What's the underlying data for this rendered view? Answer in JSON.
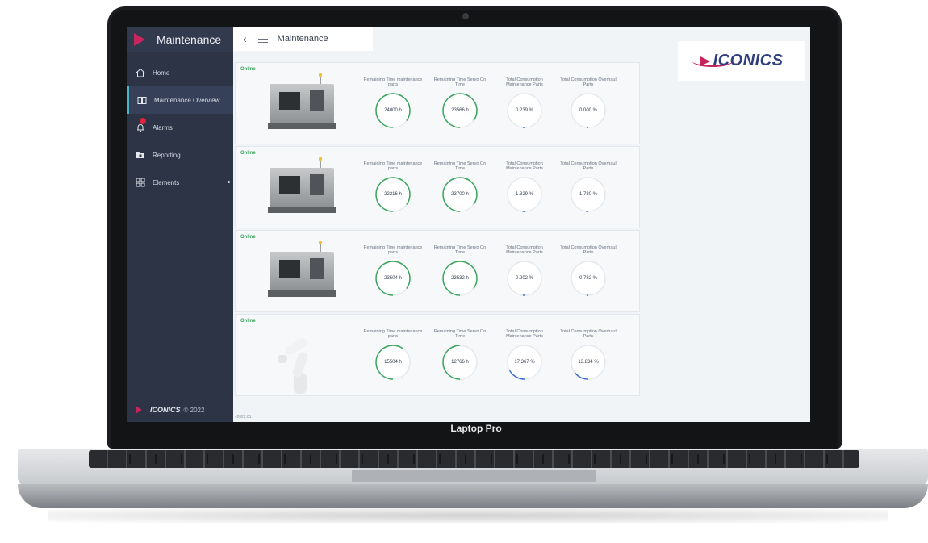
{
  "device": {
    "brand_label": "Laptop Pro"
  },
  "sidebar": {
    "title": "Maintenance",
    "items": [
      {
        "label": "Home",
        "icon": "home-icon"
      },
      {
        "label": "Maintenance Overview",
        "icon": "book-icon",
        "active": true
      },
      {
        "label": "Alarms",
        "icon": "bell-icon"
      },
      {
        "label": "Reporting",
        "icon": "folder-icon"
      },
      {
        "label": "Elements",
        "icon": "grid-icon"
      }
    ],
    "footer_brand": "ICONICS",
    "footer_copyright": "© 2022"
  },
  "topbar": {
    "title": "Maintenance"
  },
  "logo": {
    "text": "ICONICS",
    "accent_color": "#c8245e",
    "text_color": "#2f3f7e"
  },
  "version": "v2022.01",
  "machines": [
    {
      "status": "Online",
      "type": "cnc",
      "metrics": [
        {
          "label": "Remaining Time maintenance parts",
          "value": "24000 h",
          "fraction": 0.85,
          "color": "#3aa55c"
        },
        {
          "label": "Remaining Time Servo On Time",
          "value": "23566 h",
          "fraction": 0.85,
          "color": "#3aa55c"
        },
        {
          "label": "Total Consumption Maintenance Parts",
          "value": "0.239 %",
          "fraction": 0.01,
          "color": "#3b6fd6"
        },
        {
          "label": "Total Consumption Overhaul Parts",
          "value": "0.000 %",
          "fraction": 0.0,
          "color": "#3b6fd6"
        }
      ]
    },
    {
      "status": "Online",
      "type": "cnc",
      "metrics": [
        {
          "label": "Remaining Time maintenance parts",
          "value": "22216 h",
          "fraction": 0.85,
          "color": "#3aa55c"
        },
        {
          "label": "Remaining Time Servo On Time",
          "value": "23700 h",
          "fraction": 0.85,
          "color": "#3aa55c"
        },
        {
          "label": "Total Consumption Maintenance Parts",
          "value": "1.329 %",
          "fraction": 0.02,
          "color": "#3b6fd6"
        },
        {
          "label": "Total Consumption Overhaul Parts",
          "value": "1.780 %",
          "fraction": 0.02,
          "color": "#3b6fd6"
        }
      ]
    },
    {
      "status": "Online",
      "type": "cnc",
      "metrics": [
        {
          "label": "Remaining Time maintenance parts",
          "value": "23504 h",
          "fraction": 0.85,
          "color": "#3aa55c"
        },
        {
          "label": "Remaining Time Servo On Time",
          "value": "23532 h",
          "fraction": 0.85,
          "color": "#3aa55c"
        },
        {
          "label": "Total Consumption Maintenance Parts",
          "value": "0.202 %",
          "fraction": 0.01,
          "color": "#3b6fd6"
        },
        {
          "label": "Total Consumption Overhaul Parts",
          "value": "0.782 %",
          "fraction": 0.01,
          "color": "#3b6fd6"
        }
      ]
    },
    {
      "status": "Online",
      "type": "robot",
      "metrics": [
        {
          "label": "Remaining Time maintenance parts",
          "value": "15504 h",
          "fraction": 0.6,
          "color": "#3aa55c"
        },
        {
          "label": "Remaining Time Servo On Time",
          "value": "12766 h",
          "fraction": 0.5,
          "color": "#3aa55c"
        },
        {
          "label": "Total Consumption Maintenance Parts",
          "value": "17.367 %",
          "fraction": 0.17,
          "color": "#3b6fd6"
        },
        {
          "label": "Total Consumption Overhaul Parts",
          "value": "13.834 %",
          "fraction": 0.14,
          "color": "#3b6fd6"
        }
      ]
    }
  ]
}
